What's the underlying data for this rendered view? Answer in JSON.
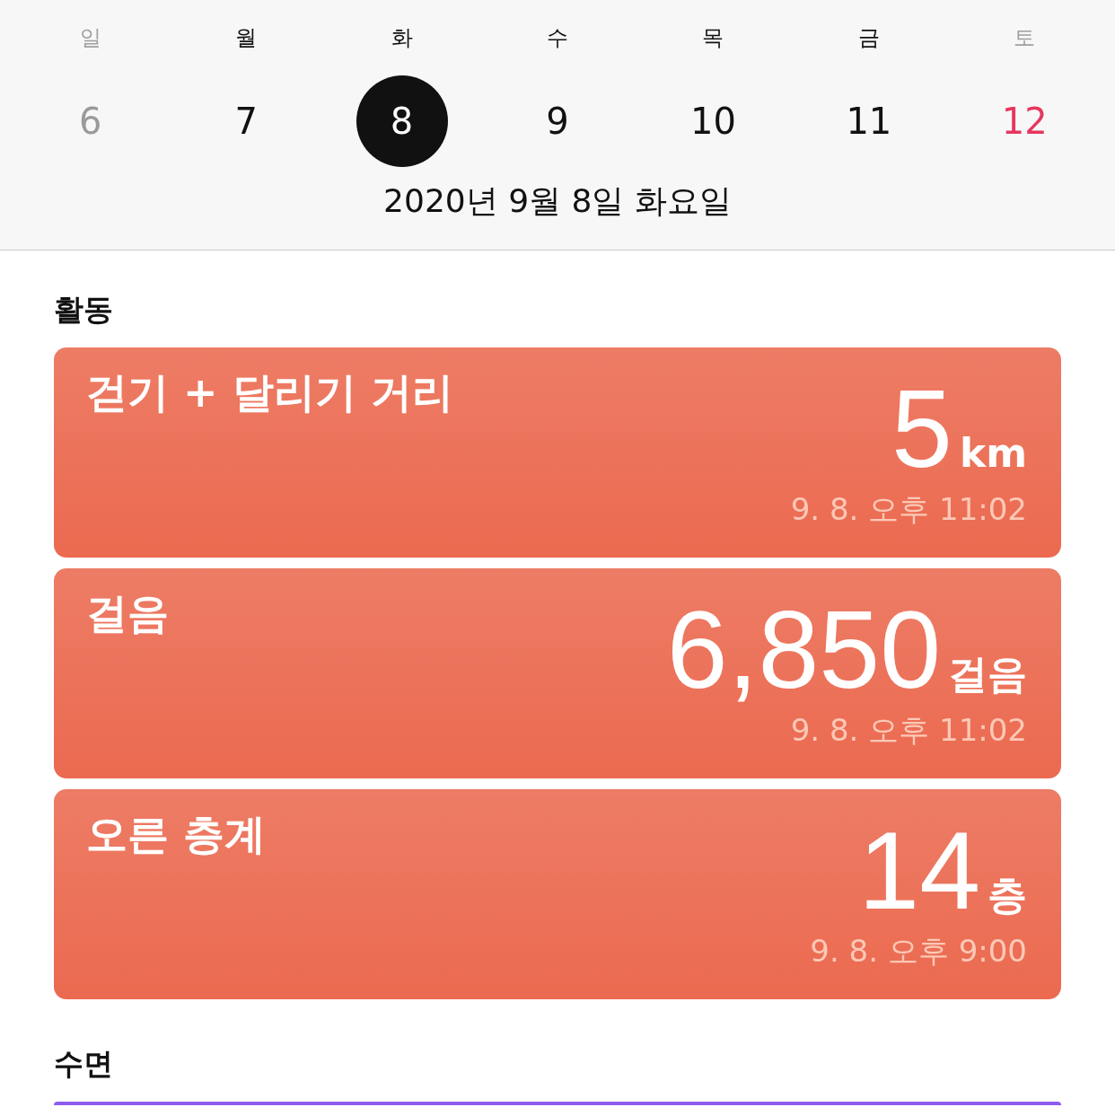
{
  "week": [
    {
      "weekday": "일",
      "day": "6",
      "color": "#9a9a9a",
      "weekend": true,
      "selected": false
    },
    {
      "weekday": "월",
      "day": "7",
      "color": "#111111",
      "weekend": false,
      "selected": false
    },
    {
      "weekday": "화",
      "day": "8",
      "color": "#111111",
      "weekend": false,
      "selected": true
    },
    {
      "weekday": "수",
      "day": "9",
      "color": "#111111",
      "weekend": false,
      "selected": false
    },
    {
      "weekday": "목",
      "day": "10",
      "color": "#111111",
      "weekend": false,
      "selected": false
    },
    {
      "weekday": "금",
      "day": "11",
      "color": "#111111",
      "weekend": false,
      "selected": false
    },
    {
      "weekday": "토",
      "day": "12",
      "color": "#e6375f",
      "weekend": true,
      "selected": false
    }
  ],
  "date_label": "2020년 9월 8일 화요일",
  "sections": [
    {
      "title": "활동",
      "cards": [
        {
          "title": "걷기 + 달리기 거리",
          "value": "5",
          "unit": "km",
          "time": "9. 8. 오후 11:02"
        },
        {
          "title": "걸음",
          "value": "6,850",
          "unit": "걸음",
          "time": "9. 8. 오후 11:02"
        },
        {
          "title": "오른 층계",
          "value": "14",
          "unit": "층",
          "time": "9. 8. 오후 9:00"
        }
      ],
      "color": "#eb6a50"
    },
    {
      "title": "수면",
      "color": "#8c5cf0"
    }
  ]
}
